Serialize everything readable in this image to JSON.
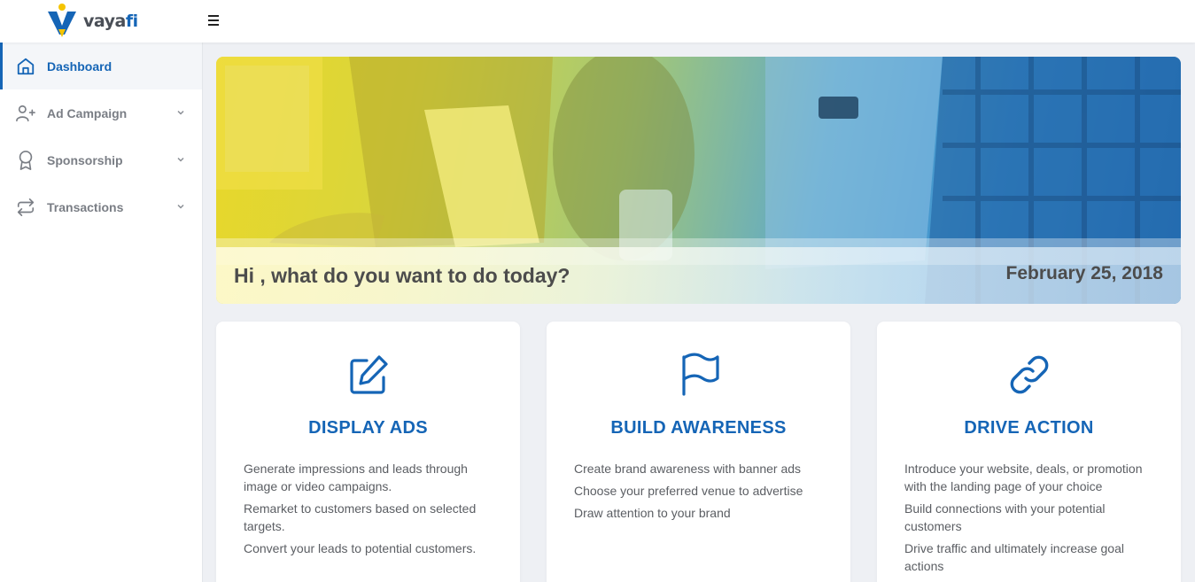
{
  "header": {
    "brand_prefix": "vaya",
    "brand_suffix": "fi",
    "logo_icon": "v-with-pin-logo",
    "menu_icon": "hamburger-icon"
  },
  "sidebar": {
    "items": [
      {
        "label": "Dashboard",
        "icon": "home-icon",
        "active": true
      },
      {
        "label": "Ad Campaign",
        "icon": "user-plus-icon",
        "expandable": true
      },
      {
        "label": "Sponsorship",
        "icon": "award-icon",
        "expandable": true
      },
      {
        "label": "Transactions",
        "icon": "repeat-icon",
        "expandable": true
      }
    ]
  },
  "hero": {
    "greeting": "Hi , what do you want to do today?",
    "date": "February 25, 2018"
  },
  "cards": [
    {
      "icon": "edit-icon",
      "title": "DISPLAY ADS",
      "items": [
        "Generate impressions and leads through image or video campaigns.",
        "Remarket to customers based on selected targets.",
        "Convert your leads to potential customers."
      ]
    },
    {
      "icon": "flag-icon",
      "title": "BUILD AWARENESS",
      "items": [
        "Create brand awareness with banner ads",
        "Choose your preferred venue to advertise",
        "Draw attention to your brand"
      ]
    },
    {
      "icon": "link-icon",
      "title": "DRIVE ACTION",
      "items": [
        "Introduce your website, deals, or promotion with the landing page of your choice",
        "Build connections with your potential customers",
        "Drive traffic and ultimately increase goal actions"
      ]
    }
  ],
  "colors": {
    "accent": "#1565b6",
    "logo_yellow": "#f5c400",
    "text_muted": "#7a7e85",
    "background": "#eef0f4"
  }
}
